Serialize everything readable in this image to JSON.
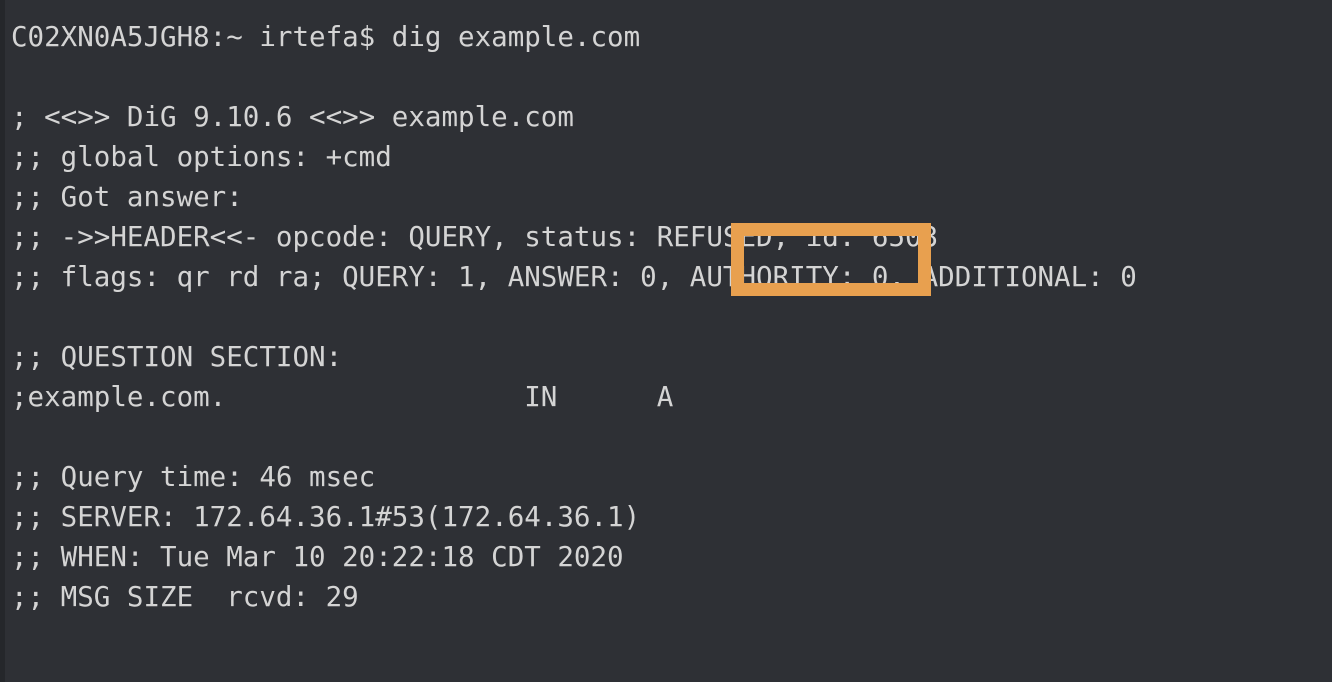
{
  "terminal": {
    "background_color": "#2e3035",
    "text_color": "#d4d4d4",
    "highlight_color": "#e8a04f",
    "prompt_line": "C02XN0A5JGH8:~ irtefa$ dig example.com",
    "lines": [
      {
        "id": "prompt",
        "text": "C02XN0A5JGH8:~ irtefa$ dig example.com"
      },
      {
        "id": "blank-1",
        "text": " "
      },
      {
        "id": "dig-version",
        "text": "; <<>> DiG 9.10.6 <<>> example.com"
      },
      {
        "id": "global-options",
        "text": ";; global options: +cmd"
      },
      {
        "id": "got-answer",
        "text": ";; Got answer:"
      },
      {
        "id": "header",
        "text": ";; ->>HEADER<<- opcode: QUERY, status: REFUSED, id: 6503"
      },
      {
        "id": "flags",
        "text": ";; flags: qr rd ra; QUERY: 1, ANSWER: 0, AUTHORITY: 0, ADDITIONAL: 0"
      },
      {
        "id": "blank-2",
        "text": " "
      },
      {
        "id": "question-section-header",
        "text": ";; QUESTION SECTION:"
      },
      {
        "id": "question-record",
        "text": ";example.com.                  IN      A"
      },
      {
        "id": "blank-3",
        "text": " "
      },
      {
        "id": "query-time",
        "text": ";; Query time: 46 msec"
      },
      {
        "id": "server",
        "text": ";; SERVER: 172.64.36.1#53(172.64.36.1)"
      },
      {
        "id": "when",
        "text": ";; WHEN: Tue Mar 10 20:22:18 CDT 2020"
      },
      {
        "id": "msg-size",
        "text": ";; MSG SIZE  rcvd: 29"
      }
    ],
    "details": {
      "hostname": "C02XN0A5JGH8",
      "cwd": "~",
      "user": "irtefa",
      "command": "dig example.com",
      "dig_version": "9.10.6",
      "queried_domain": "example.com",
      "opcode": "QUERY",
      "status": "REFUSED",
      "message_id": "6503",
      "flags": "qr rd ra",
      "counts": {
        "query": "1",
        "answer": "0",
        "authority": "0",
        "additional": "0"
      },
      "question_name": "example.com.",
      "question_class": "IN",
      "question_type": "A",
      "query_time": "46 msec",
      "server": "172.64.36.1#53(172.64.36.1)",
      "when": "Tue Mar 10 20:22:18 CDT 2020",
      "msg_size_rcvd": "29"
    },
    "highlight": {
      "target_text": "REFUSED,",
      "annotation": "status-refused-highlight"
    }
  }
}
